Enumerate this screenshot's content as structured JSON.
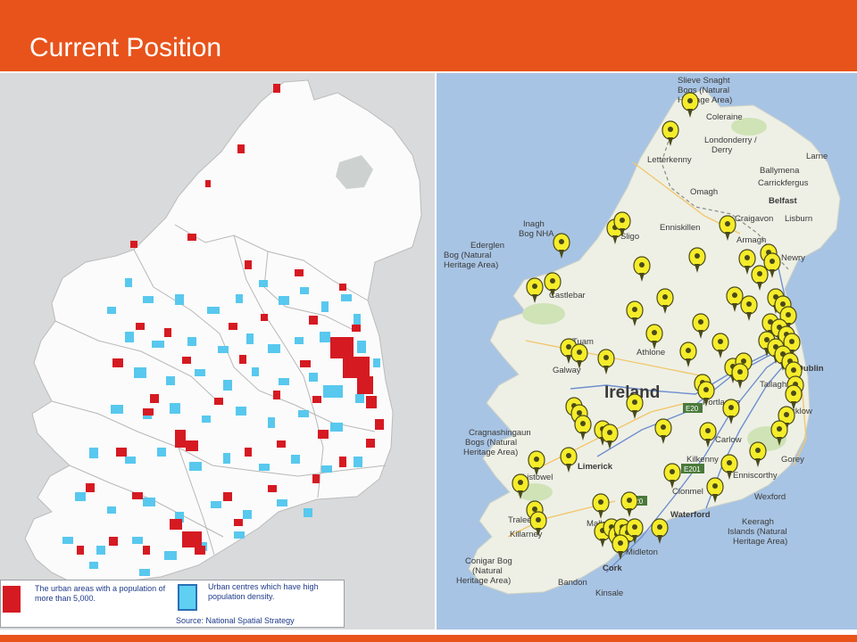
{
  "slide": {
    "title": "Current Position"
  },
  "colors": {
    "header": "#e8531b",
    "urban_red": "#d51a22",
    "urban_blue": "#5fd0f2",
    "sea": "#a8c4e4",
    "land": "#eef0e6",
    "marker": "#f5ec2a"
  },
  "left_map": {
    "legend": {
      "red_label": "The urban areas with a population of more than 5,000.",
      "blue_label": "Urban centres which have high population density.",
      "source": "Source: National Spatial Strategy"
    }
  },
  "right_map": {
    "country_label": "Ireland",
    "road_labels": [
      "E20",
      "E20",
      "E201"
    ],
    "place_labels": [
      "Slieve Snaght Bogs (Natural Heritage Area)",
      "Coleraine",
      "Londonderry / Derry",
      "Letterkenny",
      "Larne",
      "Ballymena",
      "Carrickfergus",
      "Omagh",
      "Belfast",
      "Lisburn",
      "Craigavon",
      "Armagh",
      "Enniskillen",
      "Inagh Bog NHA",
      "Ederglen Bog (Natural Heritage Area)",
      "Sligo",
      "Newry",
      "Castlebar",
      "Tuam",
      "Athlone",
      "Galway",
      "Dublin",
      "Tallaght",
      "Portlaoise",
      "Wicklow",
      "Cragnashingaun Bogs (Natural Heritage Area)",
      "Limerick",
      "Carlow",
      "Kilkenny",
      "Gorey",
      "Enniscorthy",
      "Listowel",
      "Clonmel",
      "Wexford",
      "Tralee",
      "Killarney",
      "Mallow",
      "Waterford",
      "Keeragh Islands (Natural Heritage Area)",
      "Conigar Bog (Natural Heritage Area)",
      "Cork",
      "Midleton",
      "Bandon",
      "Kinsale"
    ]
  }
}
